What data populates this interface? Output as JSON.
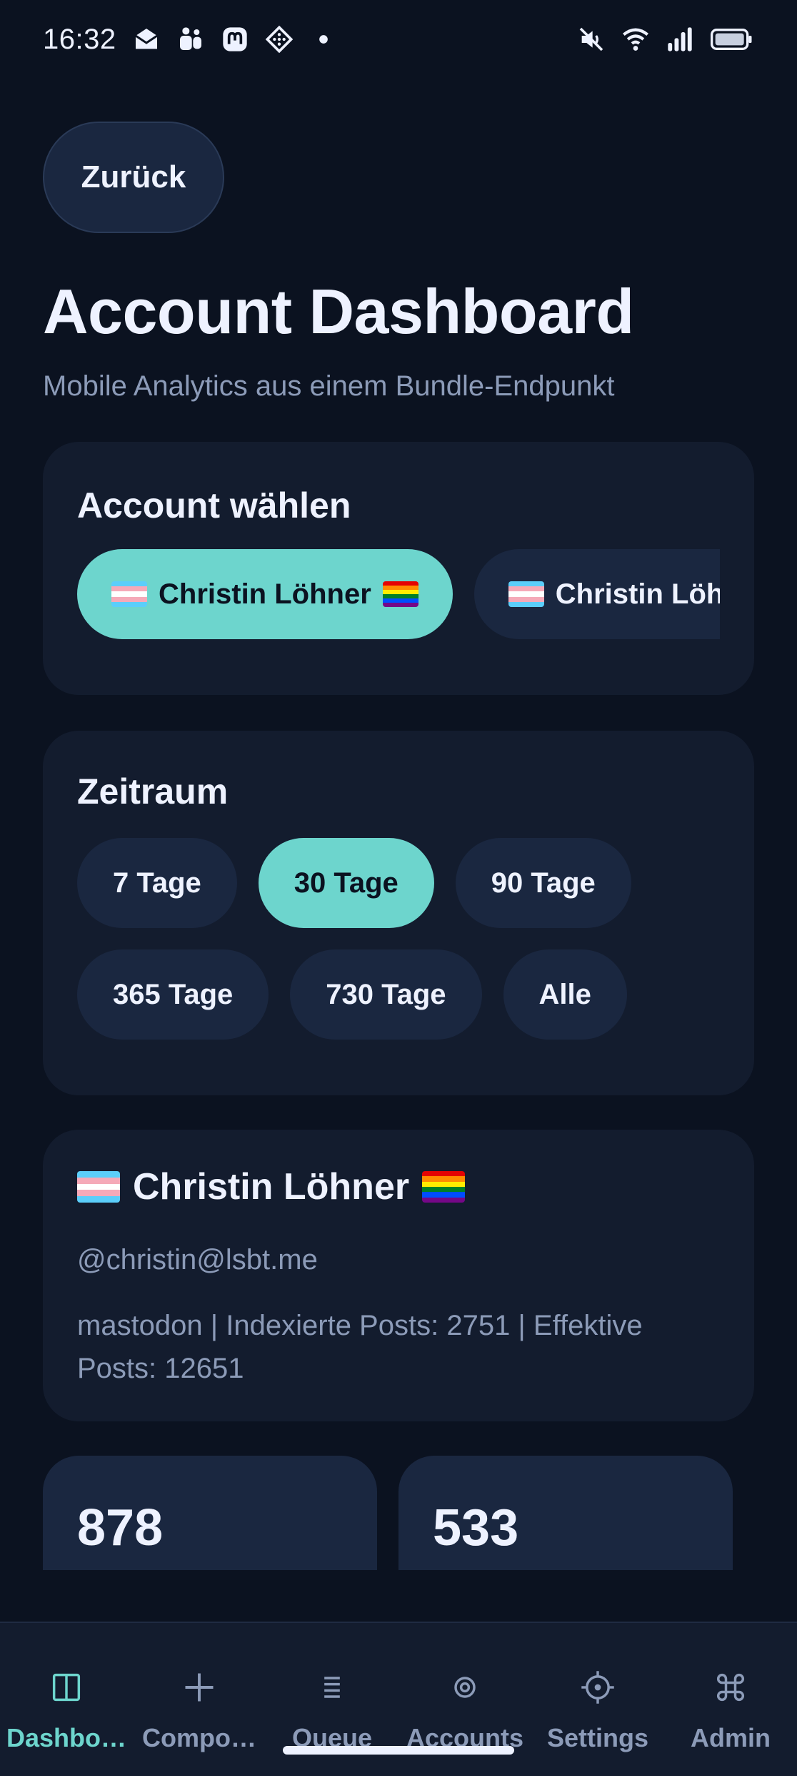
{
  "status_bar": {
    "time": "16:32",
    "left_icons": [
      "mail-icon",
      "teams-icon",
      "mastodon-icon",
      "app-grid-icon",
      "dot-icon"
    ],
    "right_icons": [
      "mute-icon",
      "wifi-icon",
      "signal-icon",
      "battery-icon"
    ]
  },
  "header": {
    "back_label": "Zurück",
    "title": "Account Dashboard",
    "subtitle": "Mobile Analytics aus einem Bundle-Endpunkt"
  },
  "account_picker": {
    "heading": "Account wählen",
    "accounts": [
      {
        "label": "Christin Löhner",
        "active": true
      },
      {
        "label": "Christin Löhn",
        "active": false
      }
    ]
  },
  "period": {
    "heading": "Zeitraum",
    "options": [
      {
        "label": "7 Tage",
        "active": false
      },
      {
        "label": "30 Tage",
        "active": true
      },
      {
        "label": "90 Tage",
        "active": false
      },
      {
        "label": "365 Tage",
        "active": false
      },
      {
        "label": "730 Tage",
        "active": false
      },
      {
        "label": "Alle",
        "active": false
      }
    ]
  },
  "profile": {
    "name": "Christin Löhner",
    "handle": "@christin@lsbt.me",
    "meta": "mastodon | Indexierte Posts: 2751 | Effektive Posts: 12651"
  },
  "stats": [
    {
      "value": "878"
    },
    {
      "value": "533"
    }
  ],
  "bottom_nav": [
    {
      "label": "Dashbo…",
      "icon": "sidebar-icon",
      "active": true
    },
    {
      "label": "Compo…",
      "icon": "plus-icon",
      "active": false
    },
    {
      "label": "Queue",
      "icon": "list-icon",
      "active": false
    },
    {
      "label": "Accounts",
      "icon": "target-icon",
      "active": false
    },
    {
      "label": "Settings",
      "icon": "gear-icon",
      "active": false
    },
    {
      "label": "Admin",
      "icon": "command-icon",
      "active": false
    }
  ],
  "colors": {
    "background": "#0b1220",
    "card": "#131c2e",
    "chip": "#1a2740",
    "accent": "#6dd5cd",
    "muted_text": "#8c9bb8",
    "text": "#eef2ff"
  }
}
